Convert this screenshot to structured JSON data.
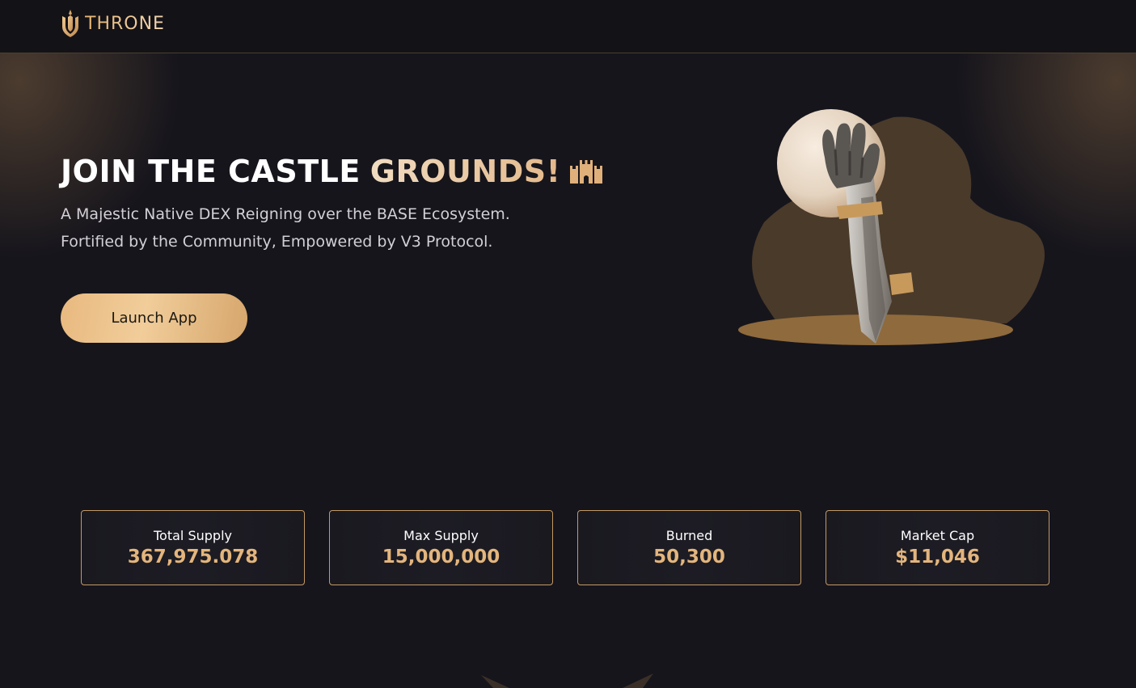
{
  "header": {
    "logo_text": "THRONE",
    "logo_icon": "throne-crest-icon"
  },
  "hero": {
    "title_white": "JOIN THE CASTLE",
    "title_gold": "GROUNDS!",
    "title_icon": "castle-icon",
    "subtitle_line1": "A Majestic Native DEX Reigning over the BASE Ecosystem.",
    "subtitle_line2": "Fortified by the Community, Empowered by V3 Protocol.",
    "launch_label": "Launch App",
    "illustration": "hand-holding-sword-illustration"
  },
  "stats": [
    {
      "label": "Total Supply",
      "value": "367,975.078"
    },
    {
      "label": "Max Supply",
      "value": "15,000,000"
    },
    {
      "label": "Burned",
      "value": "50,300"
    },
    {
      "label": "Market Cap",
      "value": "$11,046"
    }
  ],
  "colors": {
    "background": "#16151c",
    "header": "#131217",
    "accent_gold": "#e3b57d",
    "card_border": "#c49a63",
    "button_gradient_start": "#e8b97f",
    "button_gradient_end": "#d6a66c"
  }
}
